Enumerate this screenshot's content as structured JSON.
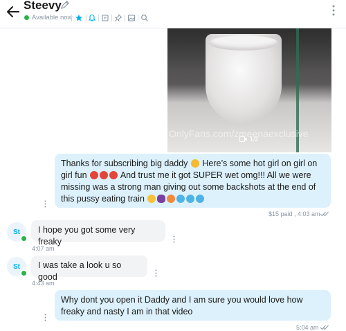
{
  "header": {
    "name": "Steevy",
    "status": "Available now",
    "icons": [
      "back-arrow-icon",
      "pencil-icon",
      "star-icon",
      "bell-icon",
      "note-icon",
      "pin-icon",
      "gallery-icon",
      "search-icon",
      "more-vertical-icon"
    ]
  },
  "media": {
    "watermark": "OnlyFans.com/zmeenaexclusive",
    "counter": "1/2"
  },
  "messages": {
    "m1": {
      "p1": "Thanks for subscribing big daddy",
      "p2": "Here’s some hot girl on girl on girl fun",
      "p3": "And trust me it got SUPER wet omg!!! All we were missing was a strong man giving out some backshots at the end of this pussy eating train",
      "meta": "$15 paid , 4:03 am"
    },
    "m2": {
      "text": "I hope you got some very freaky",
      "time": "4:07 am"
    },
    "m3": {
      "text": "I was take a look u so good",
      "time": "4:43 am"
    },
    "m4": {
      "text": "Why dont you open it Daddy and I am sure you would love how freaky and nasty I am in that video",
      "time": "5:04 am"
    },
    "avatar_initials": "St"
  },
  "colors": {
    "accent": "#00aff0",
    "outgoing_bubble": "#dcf1fb",
    "incoming_bubble": "#f2f3f5",
    "online": "#29b44a",
    "muted": "#8a96a3"
  }
}
